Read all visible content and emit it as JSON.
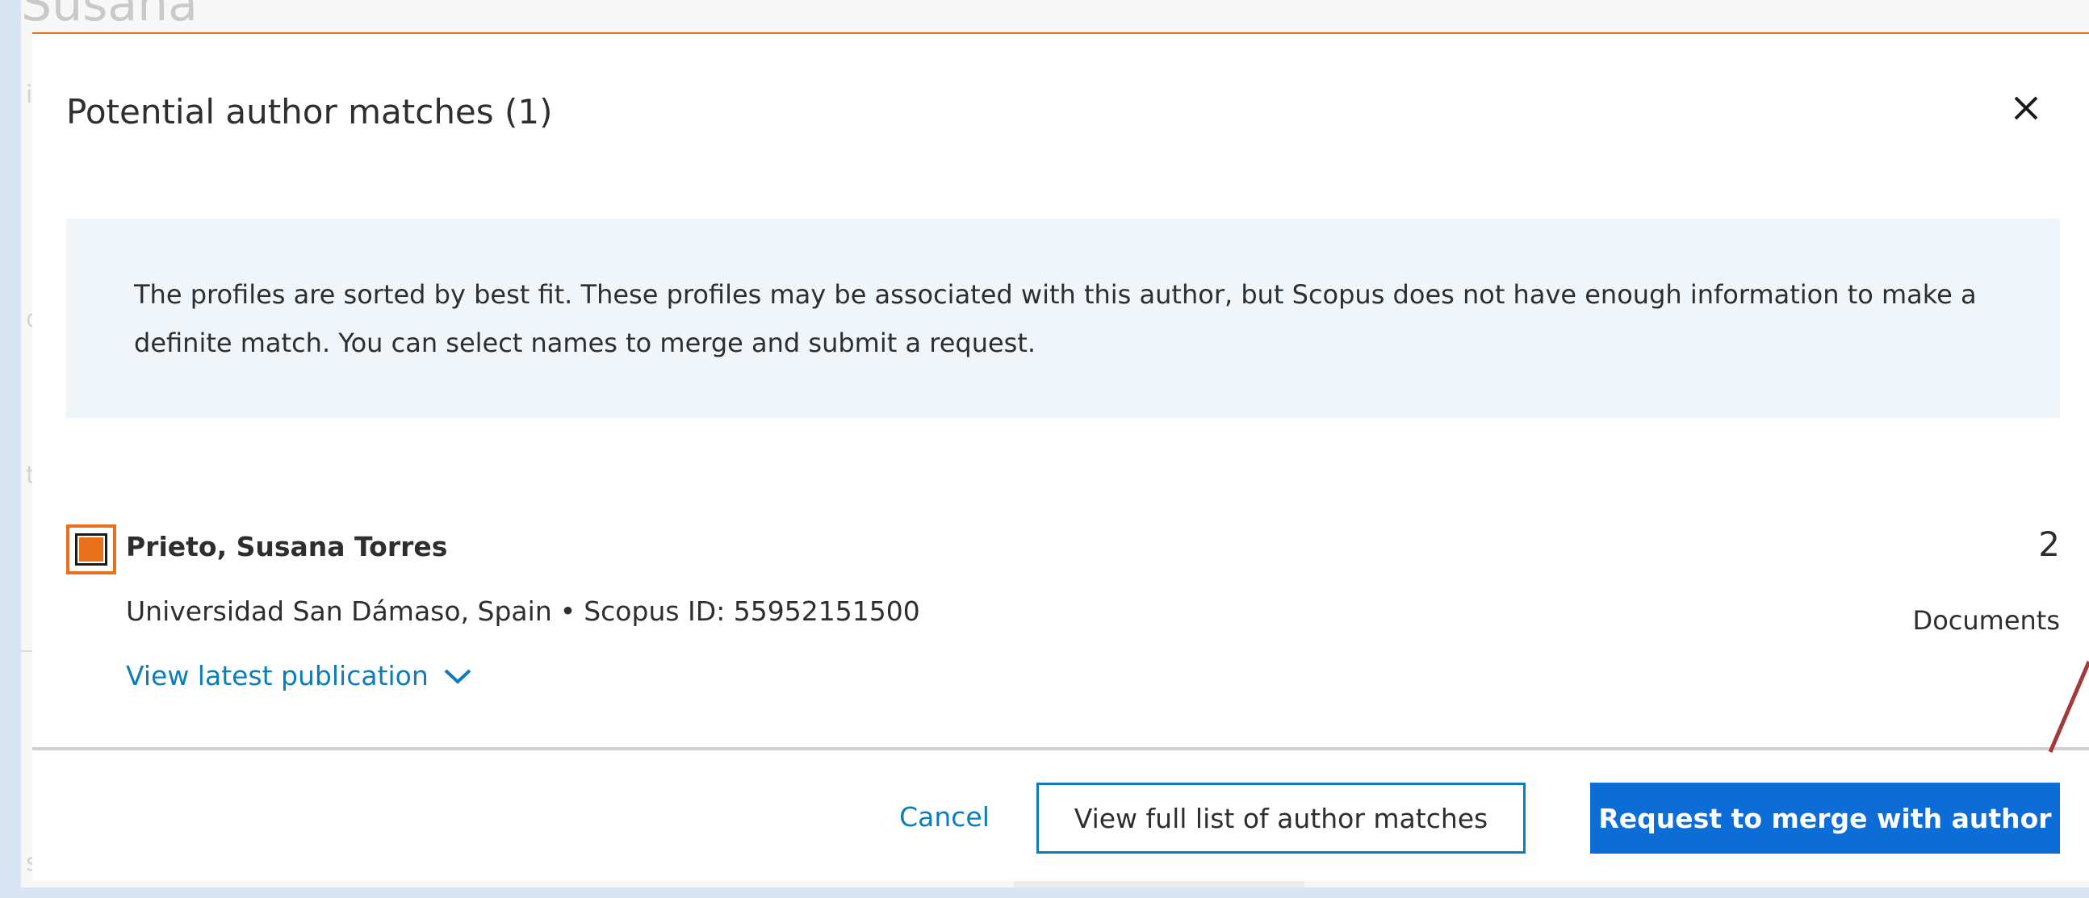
{
  "background": {
    "author_name_partial": "Susana"
  },
  "modal": {
    "title": "Potential author matches (1)",
    "close_icon": "close-icon",
    "info_text": "The profiles are sorted by best fit. These profiles may be associated with this author, but Scopus does not have enough information to make a definite match. You can select names to merge and submit a request.",
    "result": {
      "checked": true,
      "name": "Prieto, Susana Torres",
      "affiliation": "Universidad San Dámaso, Spain",
      "separator": "•",
      "scopus_id_label": "Scopus ID: 55952151500",
      "view_latest_label": "View latest publication",
      "document_count": "2",
      "documents_label": "Documents"
    },
    "footer": {
      "cancel_label": "Cancel",
      "view_full_list_label": "View full list of author matches",
      "merge_label": "Request to merge with author"
    }
  },
  "colors": {
    "accent_orange": "#e9711c",
    "link_blue": "#0c7dbb",
    "primary_button": "#0c6dd6",
    "info_background": "#f0f5fa",
    "annotation_arrow": "#a33a3a"
  }
}
